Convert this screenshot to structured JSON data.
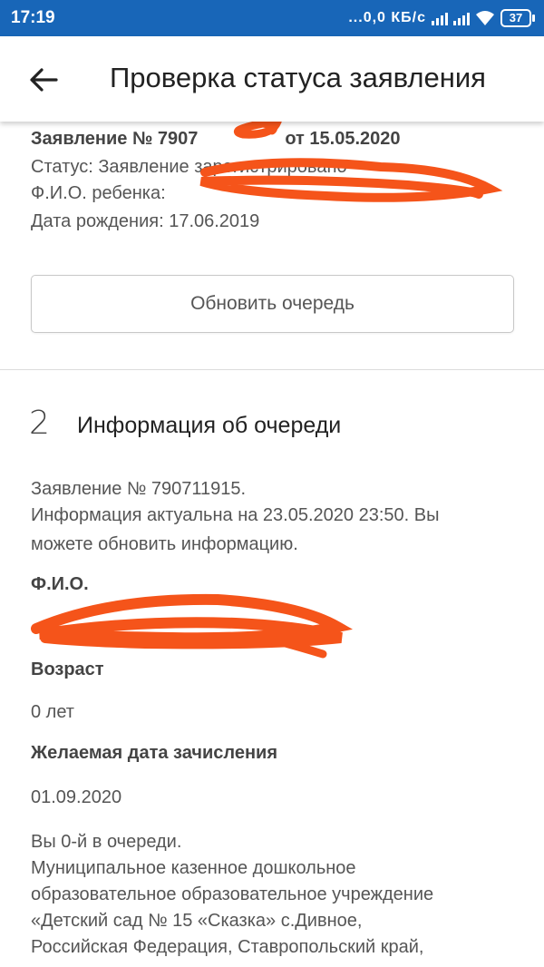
{
  "status_bar": {
    "time": "17:19",
    "network_speed": "...0,0 КБ/с",
    "battery_level": "37",
    "icons": [
      "signal-icon",
      "signal-icon",
      "wifi-icon",
      "battery-icon"
    ]
  },
  "app_bar": {
    "title": "Проверка статуса заявления",
    "back_icon": "arrow-left-icon"
  },
  "application": {
    "number_line_prefix": "Заявление № 7907",
    "number_line_suffix": "от 15.05.2020",
    "status": "Статус: Заявление зарегистрировано",
    "child_name_label": "Ф.И.О. ребенка:",
    "birth_date": "Дата рождения: 17.06.2019",
    "refresh_button": "Обновить очередь"
  },
  "queue_info": {
    "step_number": "2",
    "title": "Информация об очереди",
    "application_number": "Заявление № 790711915.",
    "updated_line1": "Информация актуальна на 23.05.2020 23:50. Вы",
    "updated_line2": "можете обновить информацию.",
    "fio_label": "Ф.И.О.",
    "age_label": "Возраст",
    "age_value": "0 лет",
    "desired_date_label": "Желаемая дата зачисления",
    "desired_date_value": "01.09.2020",
    "position_line": "Вы 0-й в очереди.",
    "institution_lines": [
      "Муниципальное казенное дошкольное",
      "образовательное образовательное учреждение",
      "«Детский сад № 15 «Сказка» с.Дивное,",
      "Российская Федерация, Ставропольский край,"
    ]
  },
  "colors": {
    "status_bar": "#1866b8",
    "redaction": "#f5541a"
  }
}
